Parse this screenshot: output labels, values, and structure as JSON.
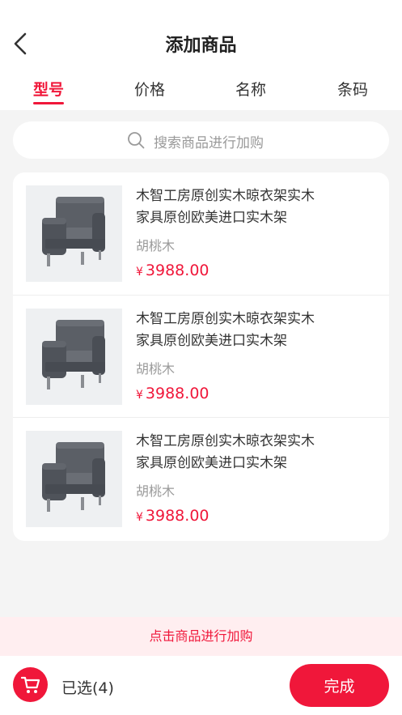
{
  "header": {
    "title": "添加商品",
    "back_icon": "chevron-left-icon"
  },
  "tabs": [
    {
      "label": "型号",
      "active": true
    },
    {
      "label": "价格",
      "active": false
    },
    {
      "label": "名称",
      "active": false
    },
    {
      "label": "条码",
      "active": false
    }
  ],
  "search": {
    "icon": "search-icon",
    "placeholder": "搜索商品进行加购"
  },
  "products": [
    {
      "name": "木智工房原创实木晾衣架实木家具原创欧美进口实木架",
      "spec": "胡桃木",
      "currency": "¥",
      "price": "3988.00",
      "image_icon": "armchair-icon"
    },
    {
      "name": "木智工房原创实木晾衣架实木家具原创欧美进口实木架",
      "spec": "胡桃木",
      "currency": "¥",
      "price": "3988.00",
      "image_icon": "armchair-icon"
    },
    {
      "name": "木智工房原创实木晾衣架实木家具原创欧美进口实木架",
      "spec": "胡桃木",
      "currency": "¥",
      "price": "3988.00",
      "image_icon": "armchair-icon"
    }
  ],
  "hint": "点击商品进行加购",
  "footer": {
    "cart_icon": "cart-icon",
    "selected_label": "已选(4)",
    "done_label": "完成"
  },
  "colors": {
    "accent": "#f0173a",
    "background": "#f4f4f4",
    "hint_bg": "#ffeef0"
  }
}
